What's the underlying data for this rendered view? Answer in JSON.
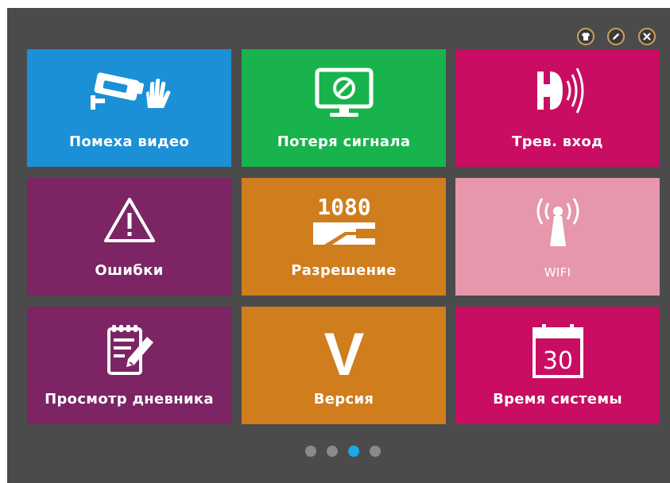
{
  "colors": {
    "panel": "#4b4b4b",
    "tile_blue": "#1b90d6",
    "tile_green": "#18b34c",
    "tile_magenta": "#c90d62",
    "tile_purple": "#7c2464",
    "tile_orange": "#d07d1e",
    "tile_pink": "#e697ab",
    "dot_inactive": "#8a8a8a",
    "dot_active": "#1aa8e8"
  },
  "top_buttons": [
    {
      "icon": "shirt-icon"
    },
    {
      "icon": "pencil-icon"
    },
    {
      "icon": "close-icon"
    }
  ],
  "tiles": [
    {
      "label": "Помеха видео",
      "icon": "camera-block-icon"
    },
    {
      "label": "Потеря сигнала",
      "icon": "monitor-no-signal-icon"
    },
    {
      "label": "Трев. вход",
      "icon": "alarm-input-icon"
    },
    {
      "label": "Ошибки",
      "icon": "warning-icon"
    },
    {
      "label": "Разрешение",
      "icon": "resolution-icon",
      "icon_text": "1080"
    },
    {
      "label": "WIFI",
      "icon": "wifi-antenna-icon"
    },
    {
      "label": "Просмотр дневника",
      "icon": "log-notepad-icon"
    },
    {
      "label": "Версия",
      "icon": "version-icon",
      "icon_text": "V"
    },
    {
      "label": "Время системы",
      "icon": "calendar-icon",
      "icon_text": "30"
    }
  ],
  "pager": {
    "count": 4,
    "active_page": 3
  }
}
